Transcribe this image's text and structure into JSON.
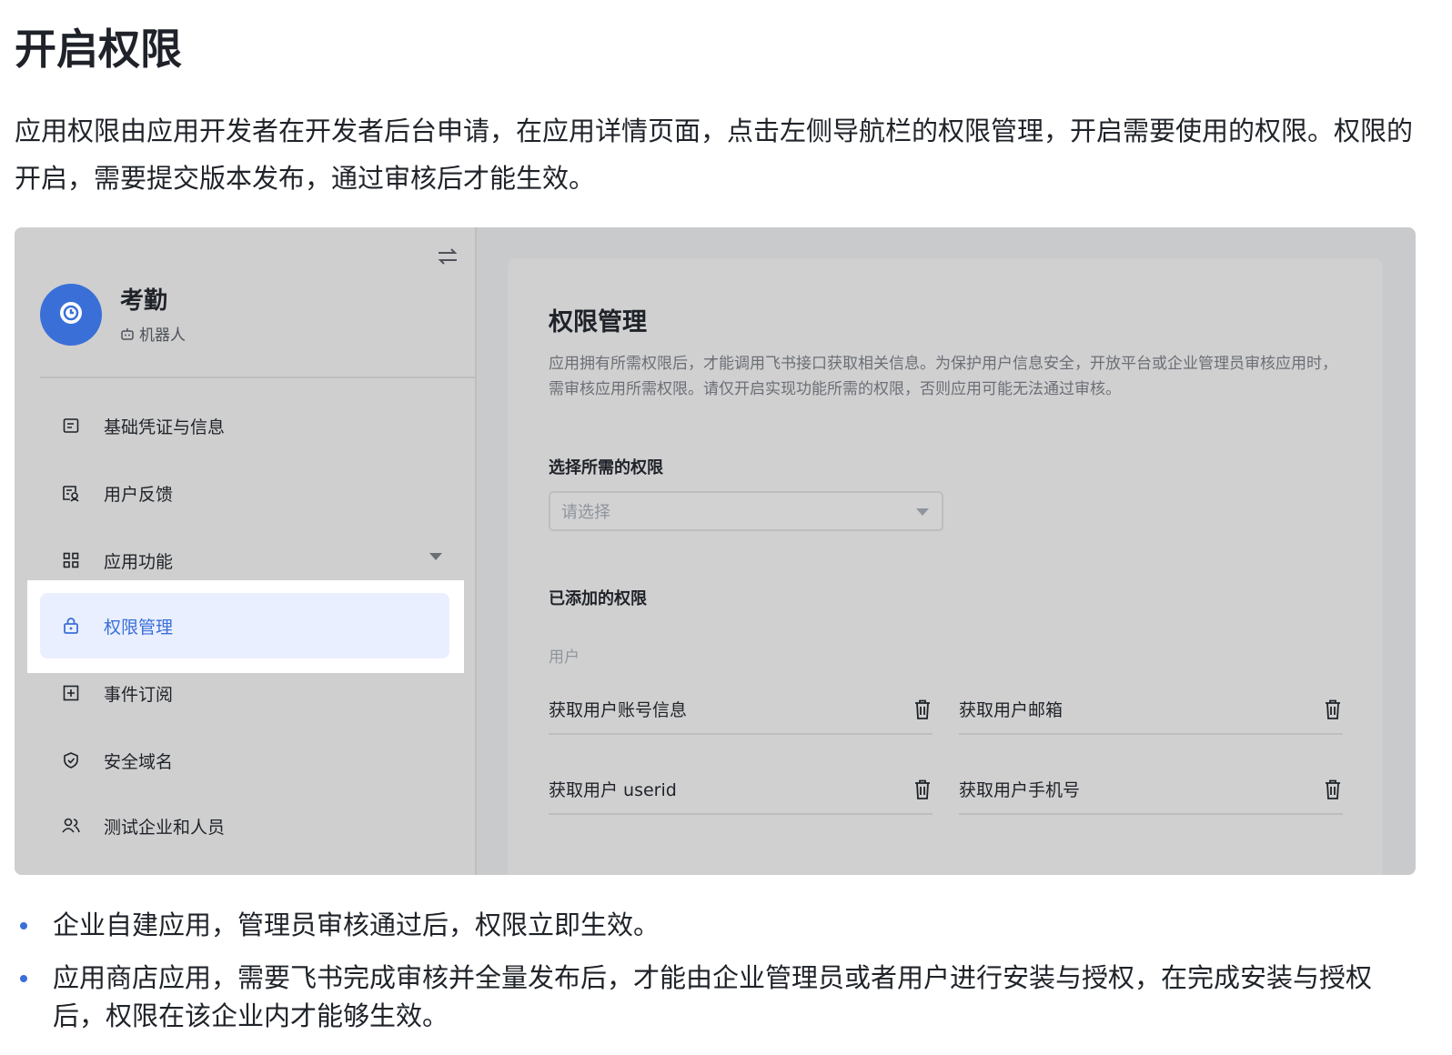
{
  "doc": {
    "title": "开启权限",
    "intro": "应用权限由应用开发者在开发者后台申请，在应用详情页面，点击左侧导航栏的权限管理，开启需要使用的权限。权限的开启，需要提交版本发布，通过审核后才能生效。",
    "bullets": [
      "企业自建应用，管理员审核通过后，权限立即生效。",
      "应用商店应用，需要飞书完成审核并全量发布后，才能由企业管理员或者用户进行安装与授权，在完成安装与授权后，权限在该企业内才能够生效。"
    ]
  },
  "sidebar": {
    "app_name": "考勤",
    "app_type": "机器人",
    "items": [
      {
        "label": "基础凭证与信息",
        "icon": "id-card-icon"
      },
      {
        "label": "用户反馈",
        "icon": "feedback-icon"
      },
      {
        "label": "应用功能",
        "icon": "grid-icon"
      },
      {
        "label": "权限管理",
        "icon": "lock-icon"
      },
      {
        "label": "事件订阅",
        "icon": "add-box-icon"
      },
      {
        "label": "安全域名",
        "icon": "shield-icon"
      },
      {
        "label": "测试企业和人员",
        "icon": "users-icon"
      }
    ]
  },
  "main": {
    "title": "权限管理",
    "description": "应用拥有所需权限后，才能调用飞书接口获取相关信息。为保护用户信息安全，开放平台或企业管理员审核应用时，需审核应用所需权限。请仅开启实现功能所需的权限，否则应用可能无法通过审核。",
    "select_label": "选择所需的权限",
    "select_placeholder": "请选择",
    "added_label": "已添加的权限",
    "group": "用户",
    "permissions": [
      "获取用户账号信息",
      "获取用户邮箱",
      "获取用户 userid",
      "获取用户手机号"
    ]
  },
  "colors": {
    "accent": "#3a6fd8",
    "highlight_bg": "#e9efff"
  }
}
